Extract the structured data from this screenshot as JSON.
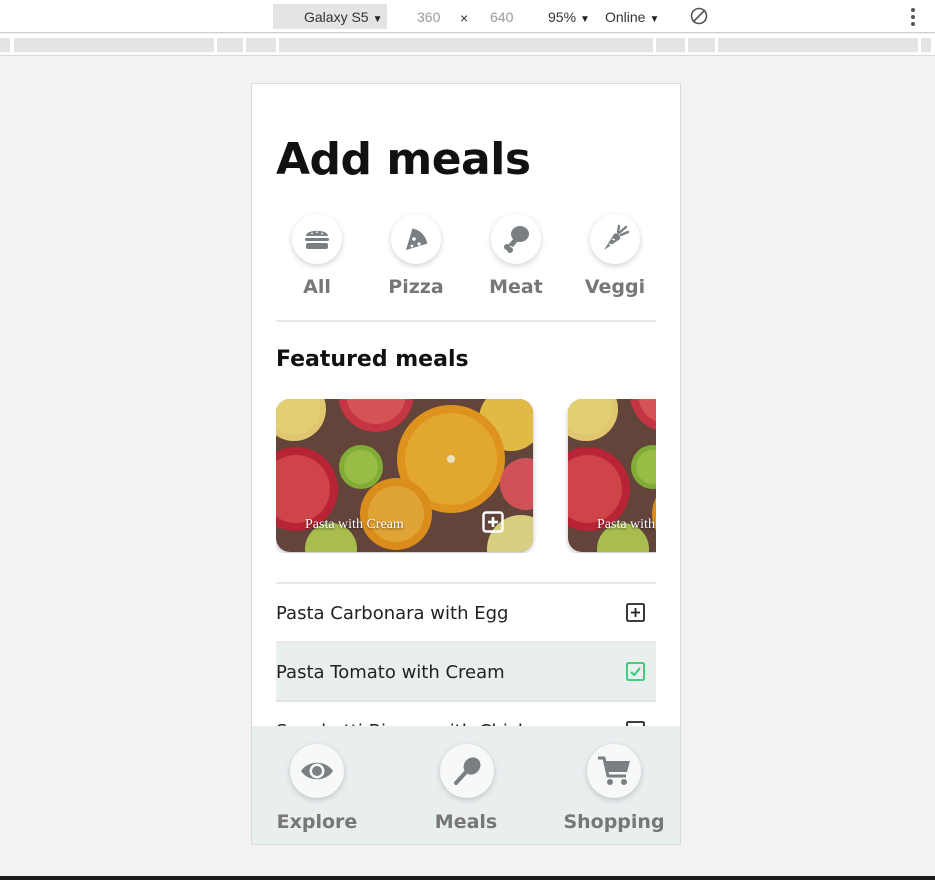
{
  "devtools": {
    "device": "Galaxy S5",
    "width": "360",
    "separator": "×",
    "height": "640",
    "zoom": "95%",
    "network": "Online",
    "caret": "▼"
  },
  "page": {
    "title": "Add meals",
    "categories": [
      {
        "label": "All",
        "icon": "burger-icon"
      },
      {
        "label": "Pizza",
        "icon": "pizza-icon"
      },
      {
        "label": "Meat",
        "icon": "drumstick-icon"
      },
      {
        "label": "Veggi",
        "icon": "carrot-icon"
      }
    ],
    "featured_title": "Featured meals",
    "featured": [
      {
        "label": "Pasta with Cream"
      },
      {
        "label": "Pasta with Cream"
      }
    ],
    "meals": [
      {
        "name": "Pasta Carbonara with Egg",
        "selected": false
      },
      {
        "name": "Pasta Tomato with Cream",
        "selected": true
      },
      {
        "name": "Spaghetti Bianco with Chicken",
        "selected": false
      }
    ]
  },
  "nav": {
    "items": [
      {
        "label": "Explore",
        "icon": "eye-icon"
      },
      {
        "label": "Meals",
        "icon": "spoon-icon"
      },
      {
        "label": "Shopping",
        "icon": "cart-icon"
      }
    ]
  },
  "colors": {
    "accent_check": "#2ecc71",
    "icon_gray": "#7a7f82",
    "nav_bg": "#e9eeef"
  }
}
